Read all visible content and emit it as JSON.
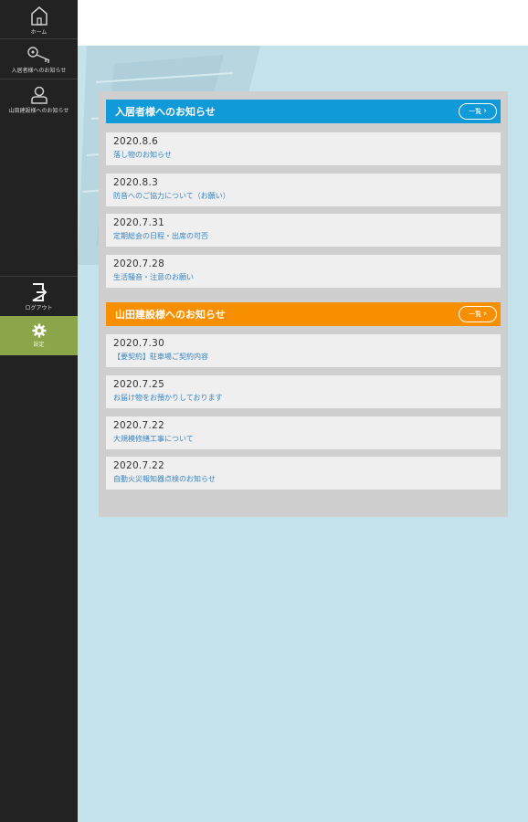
{
  "sidebar": {
    "items": [
      {
        "label": "ホーム",
        "icon": "home-icon"
      },
      {
        "label": "入居者様へのお知らせ",
        "icon": "keys-icon"
      },
      {
        "label": "山田建設様へのお知らせ",
        "icon": "person-icon"
      },
      {
        "label": "ログアウト",
        "icon": "logout-icon"
      },
      {
        "label": "設定",
        "icon": "gear-icon"
      }
    ],
    "active_color": "#8ba64a"
  },
  "sections": [
    {
      "header": "入居者様へのお知らせ",
      "more_label": "一覧",
      "color": "#109ad8",
      "items": [
        {
          "date": "2020.8.6",
          "title": "落し物のお知らせ"
        },
        {
          "date": "2020.8.3",
          "title": "防音へのご協力について（お願い）"
        },
        {
          "date": "2020.7.31",
          "title": "定期総会の日程・出席の可否"
        },
        {
          "date": "2020.7.28",
          "title": "生活騒音・注意のお願い"
        }
      ]
    },
    {
      "header": "山田建設様へのお知らせ",
      "more_label": "一覧",
      "color": "#f78f00",
      "items": [
        {
          "date": "2020.7.30",
          "title": "【要契約】駐車場ご契約内容"
        },
        {
          "date": "2020.7.25",
          "title": "お届け物をお預かりしております"
        },
        {
          "date": "2020.7.22",
          "title": "大規模修繕工事について"
        },
        {
          "date": "2020.7.22",
          "title": "自動火災報知器点検のお知らせ"
        }
      ]
    }
  ]
}
